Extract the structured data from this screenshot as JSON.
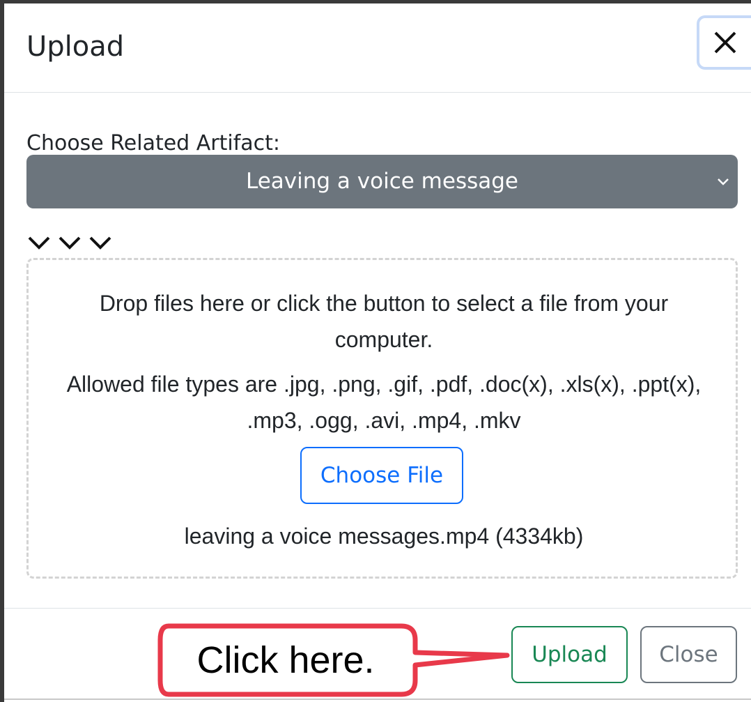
{
  "modal": {
    "title": "Upload"
  },
  "artifact": {
    "label": "Choose Related Artifact:",
    "selected": "Leaving a voice message"
  },
  "dropzone": {
    "instructions": "Drop files here or click the button to select a file from your computer.",
    "allowed_types": "Allowed file types are .jpg, .png, .gif, .pdf, .doc(x), .xls(x), .ppt(x), .mp3, .ogg, .avi, .mp4, .mkv",
    "choose_file_label": "Choose File",
    "selected_file": "leaving a voice messages.mp4 (4334kb)"
  },
  "footer": {
    "upload_label": "Upload",
    "close_label": "Close"
  },
  "callout": {
    "text": "Click here.",
    "color": "#e8394a"
  },
  "icons": [
    "close-icon",
    "chevron-down-icon",
    "arrow-down-icon"
  ],
  "colors": {
    "select_bg": "#6c757d",
    "primary": "#0d6efd",
    "success": "#198754",
    "secondary": "#6c757d"
  }
}
